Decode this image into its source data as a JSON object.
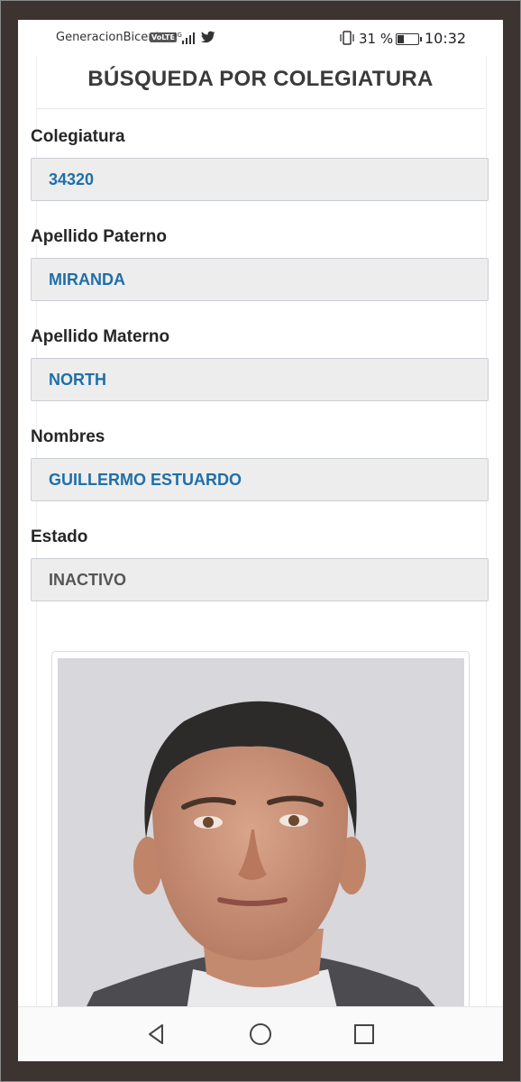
{
  "status_bar": {
    "carrier": "GeneracionBicent",
    "volte": "VoLTE",
    "network": "4G",
    "battery_percent": "31 %",
    "battery_level": 0.31,
    "time": "10:32"
  },
  "page": {
    "title": "BÚSQUEDA POR COLEGIATURA"
  },
  "fields": [
    {
      "label": "Colegiatura",
      "value": "34320"
    },
    {
      "label": "Apellido Paterno",
      "value": "MIRANDA"
    },
    {
      "label": "Apellido Materno",
      "value": "NORTH"
    },
    {
      "label": "Nombres",
      "value": "GUILLERMO ESTUARDO"
    },
    {
      "label": "Estado",
      "value": "INACTIVO"
    }
  ],
  "colors": {
    "value_blue": "#1f6fa8",
    "value_gray": "#555555",
    "field_bg": "#ededed"
  },
  "nav": {
    "back": "back-icon",
    "home": "home-icon",
    "recents": "recents-icon"
  }
}
